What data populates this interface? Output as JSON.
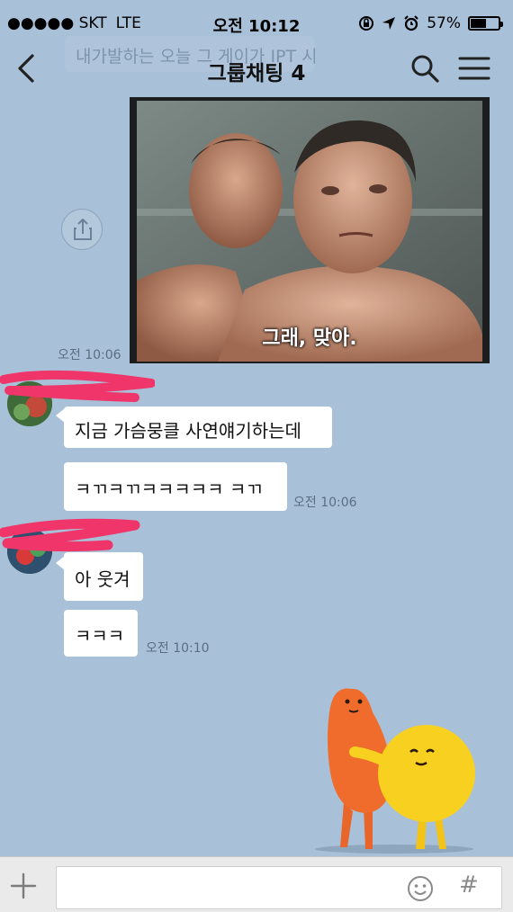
{
  "status_bar": {
    "carrier": "●●●●● SKT",
    "network": "LTE",
    "time": "오전 10:12",
    "battery_percent": "57%",
    "battery_level": 0.57
  },
  "header": {
    "title": "그룹채팅 4",
    "ghost_text": "내가발하는 오늘 그 게이가 IPT 시"
  },
  "messages": {
    "photo_caption": "그래, 맞아.",
    "photo_time": "오전 10:06",
    "msg1": "지금  가슴뭉클 사연얘기하는데",
    "msg2": "ㅋㄲㅋㄲㅋㅋㅋㅋㅋ ㅋㄲ",
    "msg2_time": "오전 10:06",
    "msg3": "아 웃겨",
    "msg4": "ㅋㅋㅋ",
    "msg4_time": "오전 10:10"
  },
  "icons": {
    "back": "chevron-left-icon",
    "search": "search-icon",
    "menu": "hamburger-menu-icon",
    "share": "share-icon",
    "plus": "plus-icon",
    "emoji": "emoji-icon",
    "hash": "#"
  },
  "colors": {
    "chat_background": "#a8c0d8",
    "bubble": "#ffffff",
    "scribble": "#f0356a"
  }
}
